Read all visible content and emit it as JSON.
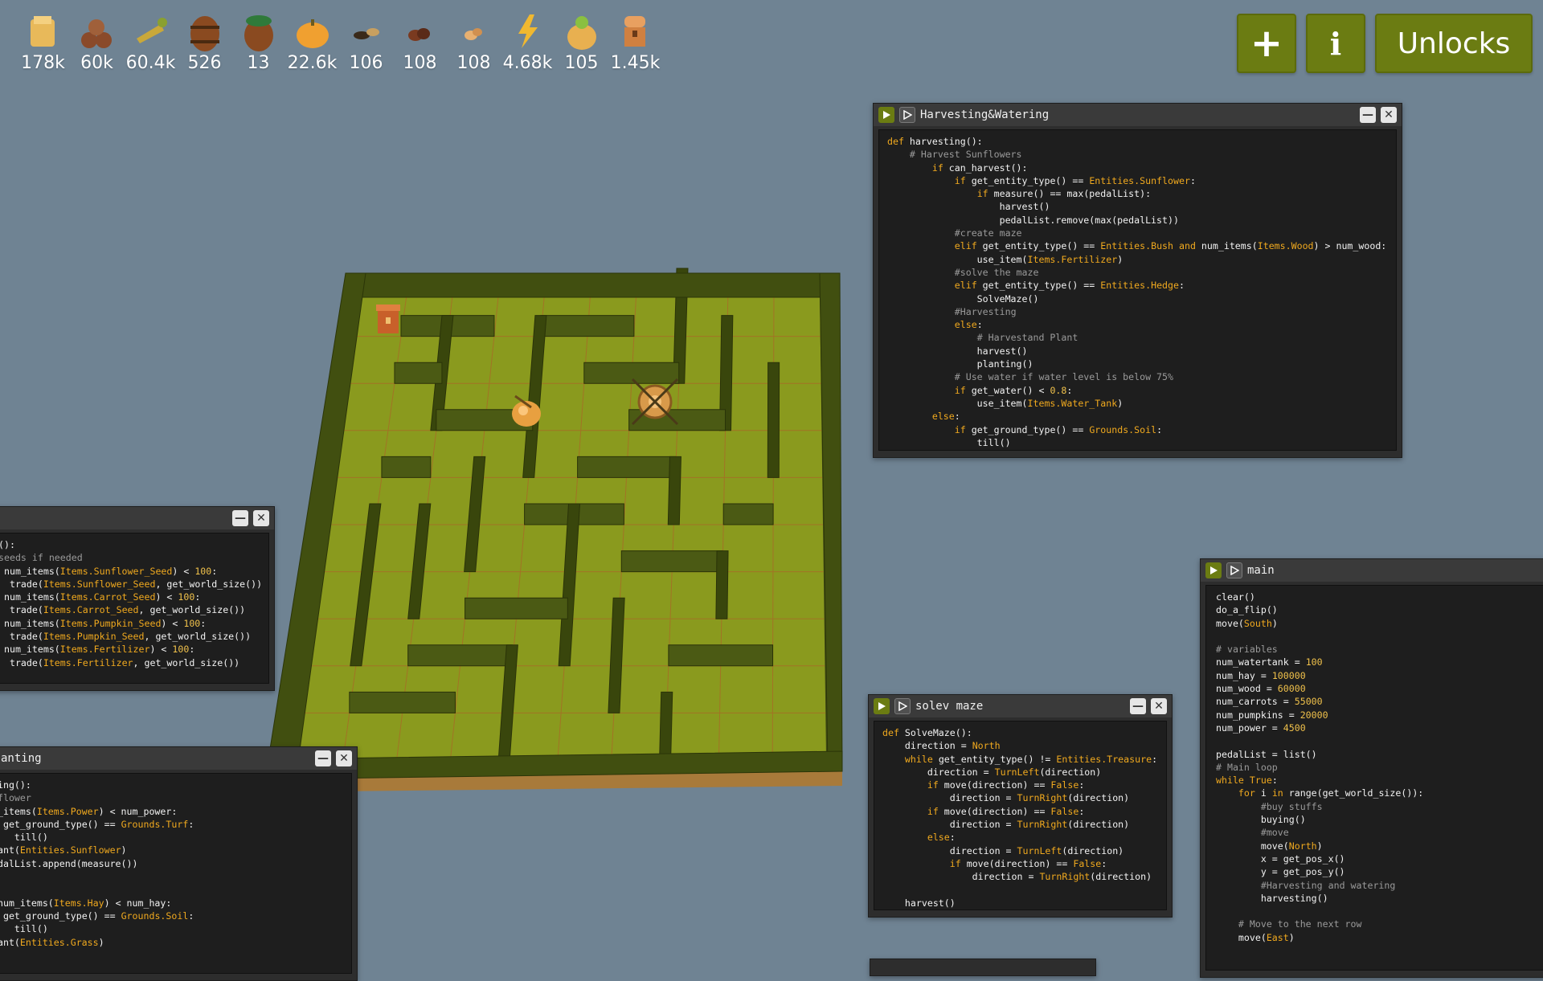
{
  "resources": [
    {
      "icon": "hay-icon",
      "value": "178k",
      "color": "#e8b95a"
    },
    {
      "icon": "wood-logs-icon",
      "value": "60k",
      "color": "#8a4a2a"
    },
    {
      "icon": "carrot-icon",
      "value": "60.4k",
      "color": "#c9a83a"
    },
    {
      "icon": "water-barrel-icon",
      "value": "526",
      "color": "#8a4a20"
    },
    {
      "icon": "fertilizer-barrel-icon",
      "value": "13",
      "color": "#2f7a3a"
    },
    {
      "icon": "pumpkin-icon",
      "value": "22.6k",
      "color": "#f0a030"
    },
    {
      "icon": "cactus-seed-icon",
      "value": "106",
      "color": "#3a2a1a"
    },
    {
      "icon": "bone-icon",
      "value": "108",
      "color": "#7a3a20"
    },
    {
      "icon": "sunflower-seed-icon",
      "value": "108",
      "color": "#e8b070"
    },
    {
      "icon": "power-icon",
      "value": "4.68k",
      "color": "#f0b830"
    },
    {
      "icon": "seed-bag-icon",
      "value": "105",
      "color": "#e8b050"
    },
    {
      "icon": "treasure-chest-icon",
      "value": "1.45k",
      "color": "#d08040"
    }
  ],
  "buttons": {
    "plus": "+",
    "info": "i",
    "unlocks": "Unlocks"
  },
  "windows": {
    "harvesting": {
      "title": "Harvesting&Watering",
      "lines": [
        [
          [
            "kw",
            "def "
          ],
          [
            "t",
            "harvesting():"
          ]
        ],
        [
          [
            "t",
            "    "
          ],
          [
            "cm",
            "# Harvest Sunflowers"
          ]
        ],
        [
          [
            "t",
            "        "
          ],
          [
            "kw",
            "if "
          ],
          [
            "t",
            "can_harvest():"
          ]
        ],
        [
          [
            "t",
            "            "
          ],
          [
            "kw",
            "if "
          ],
          [
            "t",
            "get_entity_type() == "
          ],
          [
            "en",
            "Entities.Sunflower"
          ],
          [
            "t",
            ":"
          ]
        ],
        [
          [
            "t",
            "                "
          ],
          [
            "kw",
            "if "
          ],
          [
            "t",
            "measure() == max(pedalList):"
          ]
        ],
        [
          [
            "t",
            "                    harvest()"
          ]
        ],
        [
          [
            "t",
            "                    pedalList.remove(max(pedalList))"
          ]
        ],
        [
          [
            "t",
            "            "
          ],
          [
            "cm",
            "#create maze"
          ]
        ],
        [
          [
            "t",
            "            "
          ],
          [
            "kw",
            "elif "
          ],
          [
            "t",
            "get_entity_type() == "
          ],
          [
            "en",
            "Entities.Bush"
          ],
          [
            "kw",
            " and "
          ],
          [
            "t",
            "num_items("
          ],
          [
            "en",
            "Items.Wood"
          ],
          [
            "t",
            ") > num_wood:"
          ]
        ],
        [
          [
            "t",
            "                use_item("
          ],
          [
            "en",
            "Items.Fertilizer"
          ],
          [
            "t",
            ")"
          ]
        ],
        [
          [
            "t",
            "            "
          ],
          [
            "cm",
            "#solve the maze"
          ]
        ],
        [
          [
            "t",
            "            "
          ],
          [
            "kw",
            "elif "
          ],
          [
            "t",
            "get_entity_type() == "
          ],
          [
            "en",
            "Entities.Hedge"
          ],
          [
            "t",
            ":"
          ]
        ],
        [
          [
            "t",
            "                SolveMaze()"
          ]
        ],
        [
          [
            "t",
            "            "
          ],
          [
            "cm",
            "#Harvesting"
          ]
        ],
        [
          [
            "t",
            "            "
          ],
          [
            "kw",
            "else"
          ],
          [
            "t",
            ":"
          ]
        ],
        [
          [
            "t",
            "                "
          ],
          [
            "cm",
            "# Harvestand Plant"
          ]
        ],
        [
          [
            "t",
            "                harvest()"
          ]
        ],
        [
          [
            "t",
            "                planting()"
          ]
        ],
        [
          [
            "t",
            "            "
          ],
          [
            "cm",
            "# Use water if water level is below 75%"
          ]
        ],
        [
          [
            "t",
            "            "
          ],
          [
            "kw",
            "if "
          ],
          [
            "t",
            "get_water() < "
          ],
          [
            "num",
            "0.8"
          ],
          [
            "t",
            ":"
          ]
        ],
        [
          [
            "t",
            "                use_item("
          ],
          [
            "en",
            "Items.Water_Tank"
          ],
          [
            "t",
            ")"
          ]
        ],
        [
          [
            "t",
            "        "
          ],
          [
            "kw",
            "else"
          ],
          [
            "t",
            ":"
          ]
        ],
        [
          [
            "t",
            "            "
          ],
          [
            "kw",
            "if "
          ],
          [
            "t",
            "get_ground_type() == "
          ],
          [
            "en",
            "Grounds.Soil"
          ],
          [
            "t",
            ":"
          ]
        ],
        [
          [
            "t",
            "                till()"
          ]
        ]
      ]
    },
    "buying": {
      "title": "",
      "lines": [
        [
          [
            "t",
            "():"
          ]
        ],
        [
          [
            "cm",
            "seeds if needed"
          ]
        ],
        [
          [
            "t",
            " num_items("
          ],
          [
            "en",
            "Items.Sunflower_Seed"
          ],
          [
            "t",
            ") < "
          ],
          [
            "num",
            "100"
          ],
          [
            "t",
            ":"
          ]
        ],
        [
          [
            "t",
            "  trade("
          ],
          [
            "en",
            "Items.Sunflower_Seed"
          ],
          [
            "t",
            ", get_world_size())"
          ]
        ],
        [
          [
            "t",
            " num_items("
          ],
          [
            "en",
            "Items.Carrot_Seed"
          ],
          [
            "t",
            ") < "
          ],
          [
            "num",
            "100"
          ],
          [
            "t",
            ":"
          ]
        ],
        [
          [
            "t",
            "  trade("
          ],
          [
            "en",
            "Items.Carrot_Seed"
          ],
          [
            "t",
            ", get_world_size())"
          ]
        ],
        [
          [
            "t",
            " num_items("
          ],
          [
            "en",
            "Items.Pumpkin_Seed"
          ],
          [
            "t",
            ") < "
          ],
          [
            "num",
            "100"
          ],
          [
            "t",
            ":"
          ]
        ],
        [
          [
            "t",
            "  trade("
          ],
          [
            "en",
            "Items.Pumpkin_Seed"
          ],
          [
            "t",
            ", get_world_size())"
          ]
        ],
        [
          [
            "t",
            " num_items("
          ],
          [
            "en",
            "Items.Fertilizer"
          ],
          [
            "t",
            ") < "
          ],
          [
            "num",
            "100"
          ],
          [
            "t",
            ":"
          ]
        ],
        [
          [
            "t",
            "  trade("
          ],
          [
            "en",
            "Items.Fertilizer"
          ],
          [
            "t",
            ", get_world_size())"
          ]
        ]
      ]
    },
    "planting": {
      "title": "anting",
      "lines": [
        [
          [
            "t",
            "ting():"
          ]
        ],
        [
          [
            "cm",
            "nflower"
          ]
        ],
        [
          [
            "t",
            "m_items("
          ],
          [
            "en",
            "Items.Power"
          ],
          [
            "t",
            ") < num_power:"
          ]
        ],
        [
          [
            "kw",
            "f "
          ],
          [
            "t",
            "get_ground_type() == "
          ],
          [
            "en",
            "Grounds.Turf"
          ],
          [
            "t",
            ":"
          ]
        ],
        [
          [
            "t",
            "    till()"
          ]
        ],
        [
          [
            "t",
            "lant("
          ],
          [
            "en",
            "Entities.Sunflower"
          ],
          [
            "t",
            ")"
          ]
        ],
        [
          [
            "t",
            "edalList.append(measure())"
          ]
        ],
        [
          [
            "t",
            ""
          ]
        ],
        [
          [
            "t",
            "/"
          ]
        ],
        [
          [
            "t",
            " num_items("
          ],
          [
            "en",
            "Items.Hay"
          ],
          [
            "t",
            ") < num_hay:"
          ]
        ],
        [
          [
            "kw",
            "f "
          ],
          [
            "t",
            "get_ground_type() == "
          ],
          [
            "en",
            "Grounds.Soil"
          ],
          [
            "t",
            ":"
          ]
        ],
        [
          [
            "t",
            "    till()"
          ]
        ],
        [
          [
            "t",
            "lant("
          ],
          [
            "en",
            "Entities.Grass"
          ],
          [
            "t",
            ")"
          ]
        ]
      ]
    },
    "solve": {
      "title": "solev maze",
      "lines": [
        [
          [
            "kw",
            "def "
          ],
          [
            "t",
            "SolveMaze():"
          ]
        ],
        [
          [
            "t",
            "    direction = "
          ],
          [
            "en",
            "North"
          ]
        ],
        [
          [
            "t",
            "    "
          ],
          [
            "kw",
            "while "
          ],
          [
            "t",
            "get_entity_type() != "
          ],
          [
            "en",
            "Entities.Treasure"
          ],
          [
            "t",
            ":"
          ]
        ],
        [
          [
            "t",
            "        direction = "
          ],
          [
            "en",
            "TurnLeft"
          ],
          [
            "t",
            "(direction)"
          ]
        ],
        [
          [
            "t",
            "        "
          ],
          [
            "kw",
            "if "
          ],
          [
            "t",
            "move(direction) == "
          ],
          [
            "en",
            "False"
          ],
          [
            "t",
            ":"
          ]
        ],
        [
          [
            "t",
            "            direction = "
          ],
          [
            "en",
            "TurnRight"
          ],
          [
            "t",
            "(direction)"
          ]
        ],
        [
          [
            "t",
            "        "
          ],
          [
            "kw",
            "if "
          ],
          [
            "t",
            "move(direction) == "
          ],
          [
            "en",
            "False"
          ],
          [
            "t",
            ":"
          ]
        ],
        [
          [
            "t",
            "            direction = "
          ],
          [
            "en",
            "TurnRight"
          ],
          [
            "t",
            "(direction)"
          ]
        ],
        [
          [
            "t",
            "        "
          ],
          [
            "kw",
            "else"
          ],
          [
            "t",
            ":"
          ]
        ],
        [
          [
            "t",
            "            direction = "
          ],
          [
            "en",
            "TurnLeft"
          ],
          [
            "t",
            "(direction)"
          ]
        ],
        [
          [
            "t",
            "            "
          ],
          [
            "kw",
            "if "
          ],
          [
            "t",
            "move(direction) == "
          ],
          [
            "en",
            "False"
          ],
          [
            "t",
            ":"
          ]
        ],
        [
          [
            "t",
            "                direction = "
          ],
          [
            "en",
            "TurnRight"
          ],
          [
            "t",
            "(direction)"
          ]
        ],
        [
          [
            "t",
            ""
          ]
        ],
        [
          [
            "t",
            "    harvest()"
          ]
        ]
      ]
    },
    "main": {
      "title": "main",
      "lines": [
        [
          [
            "t",
            "clear()"
          ]
        ],
        [
          [
            "t",
            "do_a_flip()"
          ]
        ],
        [
          [
            "t",
            "move("
          ],
          [
            "en",
            "South"
          ],
          [
            "t",
            ")"
          ]
        ],
        [
          [
            "t",
            ""
          ]
        ],
        [
          [
            "cm",
            "# variables"
          ]
        ],
        [
          [
            "t",
            "num_watertank = "
          ],
          [
            "num",
            "100"
          ]
        ],
        [
          [
            "t",
            "num_hay = "
          ],
          [
            "num",
            "100000"
          ]
        ],
        [
          [
            "t",
            "num_wood = "
          ],
          [
            "num",
            "60000"
          ]
        ],
        [
          [
            "t",
            "num_carrots = "
          ],
          [
            "num",
            "55000"
          ]
        ],
        [
          [
            "t",
            "num_pumpkins = "
          ],
          [
            "num",
            "20000"
          ]
        ],
        [
          [
            "t",
            "num_power = "
          ],
          [
            "num",
            "4500"
          ]
        ],
        [
          [
            "t",
            ""
          ]
        ],
        [
          [
            "t",
            "pedalList = list()"
          ]
        ],
        [
          [
            "cm",
            "# Main loop"
          ]
        ],
        [
          [
            "kw",
            "while "
          ],
          [
            "en",
            "True"
          ],
          [
            "t",
            ":"
          ]
        ],
        [
          [
            "t",
            "    "
          ],
          [
            "kw",
            "for "
          ],
          [
            "t",
            "i "
          ],
          [
            "kw",
            "in "
          ],
          [
            "t",
            "range(get_world_size()):"
          ]
        ],
        [
          [
            "t",
            "        "
          ],
          [
            "cm",
            "#buy stuffs"
          ]
        ],
        [
          [
            "t",
            "        buying()"
          ]
        ],
        [
          [
            "t",
            "        "
          ],
          [
            "cm",
            "#move"
          ]
        ],
        [
          [
            "t",
            "        move("
          ],
          [
            "en",
            "North"
          ],
          [
            "t",
            ")"
          ]
        ],
        [
          [
            "t",
            "        x = get_pos_x()"
          ]
        ],
        [
          [
            "t",
            "        y = get_pos_y()"
          ]
        ],
        [
          [
            "t",
            "        "
          ],
          [
            "cm",
            "#Harvesting and watering"
          ]
        ],
        [
          [
            "t",
            "        harvesting()"
          ]
        ],
        [
          [
            "t",
            ""
          ]
        ],
        [
          [
            "t",
            "    "
          ],
          [
            "cm",
            "# Move to the next row"
          ]
        ],
        [
          [
            "t",
            "    move("
          ],
          [
            "en",
            "East"
          ],
          [
            "t",
            ")"
          ]
        ]
      ]
    }
  }
}
